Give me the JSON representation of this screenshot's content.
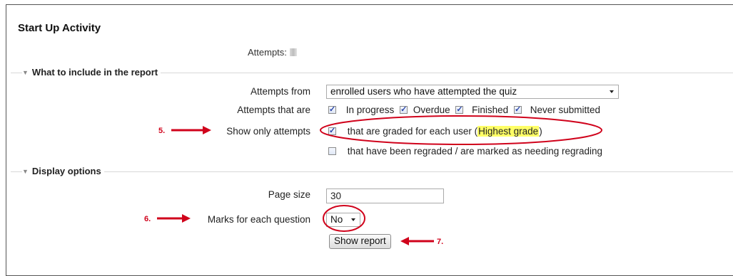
{
  "heading": {
    "title": "Start Up Activity",
    "attempts_label": "Attempts:"
  },
  "report_section": {
    "legend": "What to include in the report",
    "attempts_from": {
      "label": "Attempts from",
      "selected": "enrolled users who have attempted the quiz"
    },
    "attempts_that_are": {
      "label": "Attempts that are",
      "options": [
        {
          "label": "In progress",
          "checked": true
        },
        {
          "label": "Overdue",
          "checked": true
        },
        {
          "label": "Finished",
          "checked": true
        },
        {
          "label": "Never submitted",
          "checked": true
        }
      ]
    },
    "show_only": {
      "label": "Show only attempts",
      "graded_text": "that are graded for each user (",
      "graded_method": "Highest grade",
      "graded_close": ")",
      "regraded_text": "that have been regraded / are marked as needing regrading"
    }
  },
  "display_section": {
    "legend": "Display options",
    "page_size": {
      "label": "Page size",
      "value": "30"
    },
    "marks": {
      "label": "Marks for each question",
      "selected": "No"
    },
    "show_report_button": "Show report"
  },
  "annotations": {
    "step5": "5.",
    "step6": "6.",
    "step7": "7.",
    "color": "#d0021b"
  }
}
